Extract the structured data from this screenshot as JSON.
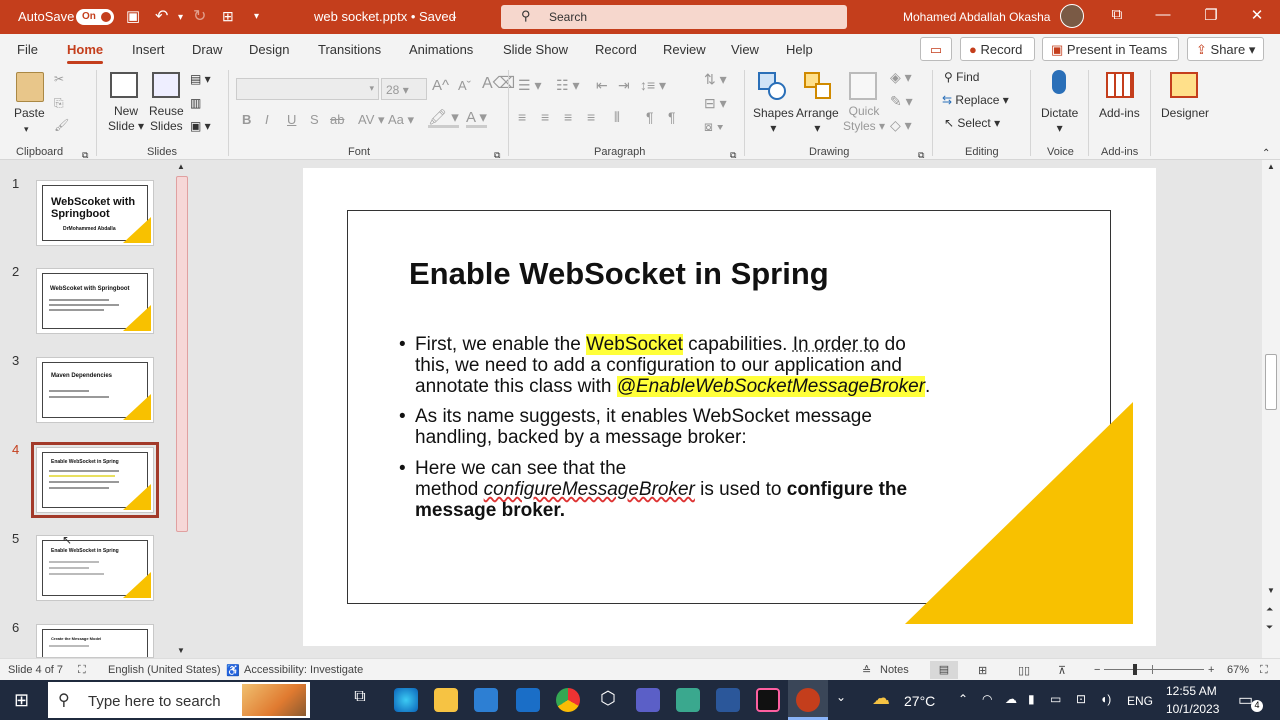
{
  "titlebar": {
    "autosave": "AutoSave",
    "autosave_state": "On",
    "filename": "web socket.pptx • Saved",
    "search_placeholder": "Search",
    "user": "Mohamed Abdallah Okasha"
  },
  "tabs": [
    "File",
    "Home",
    "Insert",
    "Draw",
    "Design",
    "Transitions",
    "Animations",
    "Slide Show",
    "Record",
    "Review",
    "View",
    "Help"
  ],
  "actions": {
    "record": "Record",
    "present": "Present in Teams",
    "share": "Share"
  },
  "ribbon": {
    "paste": "Paste",
    "new_slide_1": "New",
    "new_slide_2": "Slide",
    "reuse_1": "Reuse",
    "reuse_2": "Slides",
    "font_size": "28",
    "shapes": "Shapes",
    "arrange": "Arrange",
    "quick_styles_1": "Quick",
    "quick_styles_2": "Styles",
    "find": "Find",
    "replace": "Replace",
    "select": "Select",
    "dictate": "Dictate",
    "addins": "Add-ins",
    "designer": "Designer",
    "groups": {
      "clipboard": "Clipboard",
      "slides": "Slides",
      "font": "Font",
      "paragraph": "Paragraph",
      "drawing": "Drawing",
      "editing": "Editing",
      "voice": "Voice",
      "addins": "Add-ins"
    }
  },
  "thumbnails": [
    {
      "num": "1",
      "title": "WebScoket with Springboot",
      "sub": "DrMohammed Abdalla"
    },
    {
      "num": "2",
      "title": "WebScoket with Springboot"
    },
    {
      "num": "3",
      "title": "Maven Dependencies"
    },
    {
      "num": "4",
      "title": "Enable WebSocket in Spring"
    },
    {
      "num": "5",
      "title": "Enable WebSocket in Spring"
    },
    {
      "num": "6",
      "title": "Create the Message Model"
    }
  ],
  "slide": {
    "title": "Enable WebSocket in Spring",
    "b1_pre": "First, we enable the ",
    "b1_hl": "WebSocket",
    "b1_mid": " capabilities. ",
    "b1_sq": "In order to",
    "b1_post": " do",
    "b1_l2": "this, we need to add a configuration to our application and",
    "b1_l3_pre": "annotate this class with ",
    "b1_l3_hl": "@EnableWebSocketMessageBroker",
    "b1_l3_post": ".",
    "b2_l1": "As its name suggests, it enables WebSocket message",
    "b2_l2": "handling, backed by a message broker:",
    "b3_l1": " Here we can see that the",
    "b3_l2_pre": "method ",
    "b3_l2_it": "configureMessageBroker",
    "b3_l2_mid": " is used to ",
    "b3_l2_bold": "configure the",
    "b3_l3_bold": "message broker."
  },
  "status": {
    "slide_of": "Slide 4 of 7",
    "language": "English (United States)",
    "accessibility": "Accessibility: Investigate",
    "notes": "Notes",
    "zoom": "67%"
  },
  "taskbar": {
    "search_placeholder": "Type here to search",
    "temperature": "27°C",
    "lang": "ENG",
    "time": "12:55 AM",
    "date": "10/1/2023",
    "notif": "4"
  },
  "colors": {
    "accent": "#c43e1c",
    "triangle": "#f8c100",
    "highlight": "#ffff3a"
  }
}
